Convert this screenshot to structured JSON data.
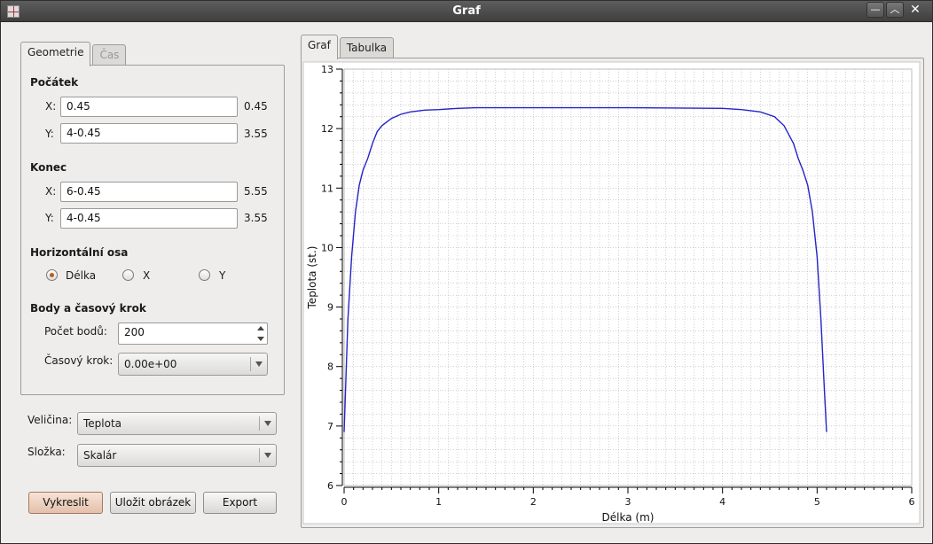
{
  "window": {
    "title": "Graf"
  },
  "left_tabs": [
    "Geometrie",
    "Čas"
  ],
  "geometry": {
    "start": {
      "title": "Počátek",
      "x": {
        "label": "X:",
        "input": "0.45",
        "value": "0.45"
      },
      "y": {
        "label": "Y:",
        "input": "4-0.45",
        "value": "3.55"
      }
    },
    "end": {
      "title": "Konec",
      "x": {
        "label": "X:",
        "input": "6-0.45",
        "value": "5.55"
      },
      "y": {
        "label": "Y:",
        "input": "4-0.45",
        "value": "3.55"
      }
    },
    "axis": {
      "title": "Horizontální osa",
      "options": [
        "Délka",
        "X",
        "Y"
      ],
      "selected": "Délka"
    },
    "points": {
      "title": "Body a časový krok",
      "count_label": "Počet bodů:",
      "count_value": "200",
      "step_label": "Časový krok:",
      "step_value": "0.00e+00"
    }
  },
  "quantity": {
    "label": "Veličina:",
    "value": "Teplota"
  },
  "component": {
    "label": "Složka:",
    "value": "Skalár"
  },
  "buttons": {
    "plot": "Vykreslit",
    "save_image": "Uložit obrázek",
    "export": "Export"
  },
  "right_tabs": [
    "Graf",
    "Tabulka"
  ],
  "colors": {
    "line": "#2424c8",
    "grid": "#b4b4b4",
    "accent": "#c15a22"
  },
  "chart_data": {
    "type": "line",
    "xlabel": "Délka (m)",
    "ylabel": "Teplota (st.)",
    "xlim": [
      0,
      6
    ],
    "ylim": [
      6,
      13
    ],
    "xticks": [
      "0",
      "1",
      "2",
      "3",
      "4",
      "5",
      "6"
    ],
    "yticks": [
      "6",
      "7",
      "8",
      "9",
      "10",
      "11",
      "12",
      "13"
    ],
    "grid": true,
    "series": [
      {
        "x": [
          0.0,
          0.04,
          0.08,
          0.12,
          0.16,
          0.2,
          0.25,
          0.3,
          0.35,
          0.4,
          0.5,
          0.6,
          0.7,
          0.85,
          1.0,
          1.2,
          1.4,
          2.0,
          3.0,
          4.0,
          4.2,
          4.4,
          4.55,
          4.65,
          4.75,
          4.8,
          4.85,
          4.9,
          4.95,
          5.0,
          5.04,
          5.08,
          5.1
        ],
        "y": [
          6.9,
          8.8,
          9.85,
          10.6,
          11.05,
          11.3,
          11.5,
          11.75,
          11.95,
          12.05,
          12.17,
          12.24,
          12.28,
          12.31,
          12.32,
          12.34,
          12.35,
          12.35,
          12.35,
          12.34,
          12.32,
          12.28,
          12.2,
          12.05,
          11.75,
          11.5,
          11.3,
          11.05,
          10.6,
          9.85,
          8.8,
          7.5,
          6.9
        ]
      }
    ]
  }
}
